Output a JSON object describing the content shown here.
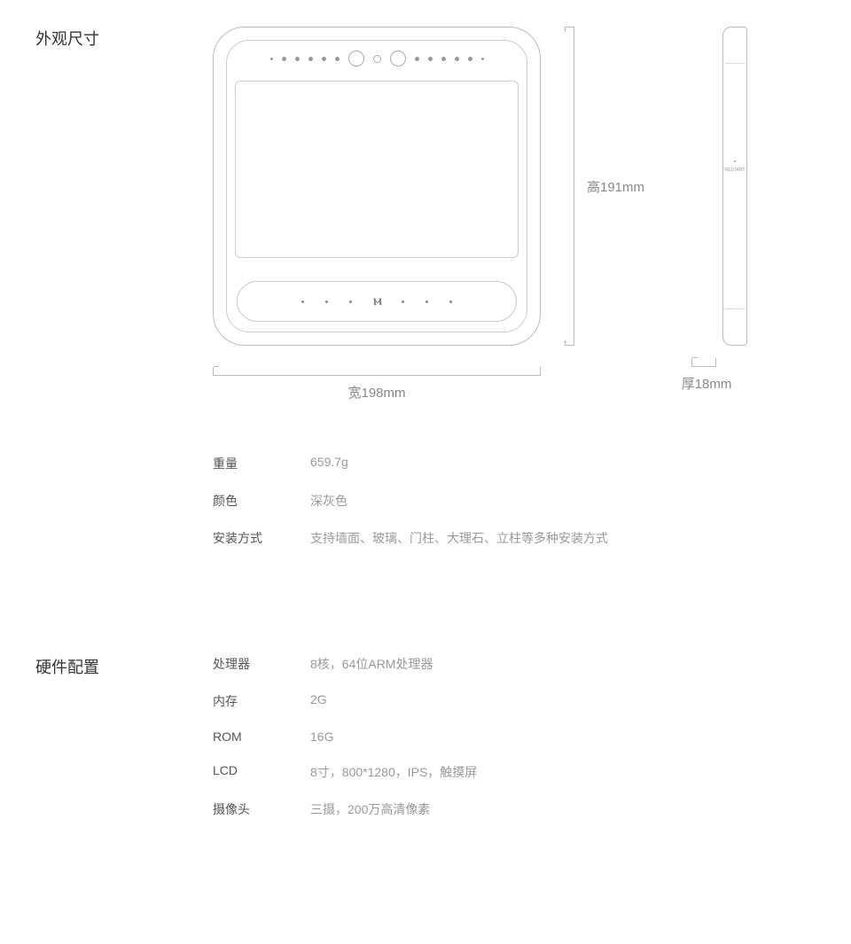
{
  "sections": {
    "dimensions": {
      "title": "外观尺寸",
      "height_label": "高191mm",
      "width_label": "宽198mm",
      "thickness_label": "厚18mm",
      "side_restart": "RESTART",
      "specs": [
        {
          "label": "重量",
          "value": "659.7g"
        },
        {
          "label": "颜色",
          "value": "深灰色"
        },
        {
          "label": "安装方式",
          "value": "支持墙面、玻璃、门柱、大理石、立柱等多种安装方式"
        }
      ]
    },
    "hardware": {
      "title": "硬件配置",
      "specs": [
        {
          "label": "处理器",
          "value": "8核，64位ARM处理器"
        },
        {
          "label": "内存",
          "value": "2G"
        },
        {
          "label": "ROM",
          "value": "16G"
        },
        {
          "label": "LCD",
          "value": "8寸，800*1280，IPS，触摸屏"
        },
        {
          "label": "摄像头",
          "value": "三摄，200万高清像素"
        }
      ]
    }
  }
}
